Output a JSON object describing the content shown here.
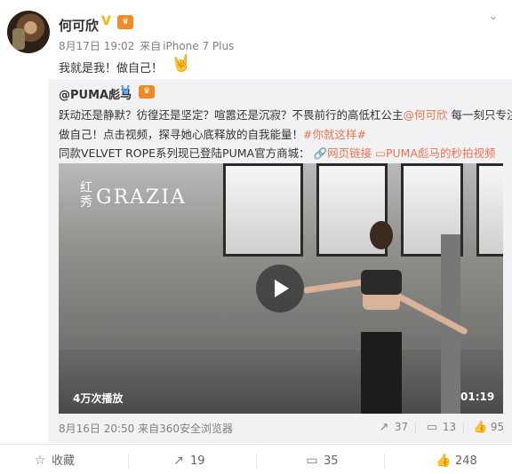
{
  "post": {
    "author": "何可欣",
    "verified_mark": "V",
    "member_badge": "♛",
    "date": "8月17日 19:02",
    "source_prefix": "来自",
    "source": "iPhone 7 Plus",
    "text": "我就是我！做自己！",
    "emoji_icon": "rock-hand"
  },
  "repost": {
    "author": "@PUMA彪马",
    "verified_mark": "V",
    "member_badge": "♛",
    "line1": "跃动还是静默？彷徨还是坚定？喧嚣还是沉寂？不畏前行的高低杠公主",
    "mention": "@何可欣",
    "line1_tail": " 每一刻只专注",
    "line2": "做自己！点击视频，探寻她心底释放的自我能量！",
    "hashtag": "#你就这样#",
    "line3": "同款VELVET ROPE系列现已登陆PUMA官方商城：",
    "link1": "网页链接",
    "link2": "PUMA彪马的秒拍视频",
    "video": {
      "logo_cn": "红秀",
      "logo_en": "GRAZIA",
      "views": "4万次播放",
      "duration": "01:19"
    },
    "date": "8月16日 20:50",
    "source_prefix": "来自",
    "source": "360安全浏览器",
    "reposts": "37",
    "comments": "13",
    "likes": "95"
  },
  "actions": {
    "favorite": "收藏",
    "repost": "19",
    "comment": "35",
    "like": "248"
  },
  "colors": {
    "link": "#eb7350",
    "muted": "#808080",
    "repost_bg": "#f2f2f5"
  }
}
